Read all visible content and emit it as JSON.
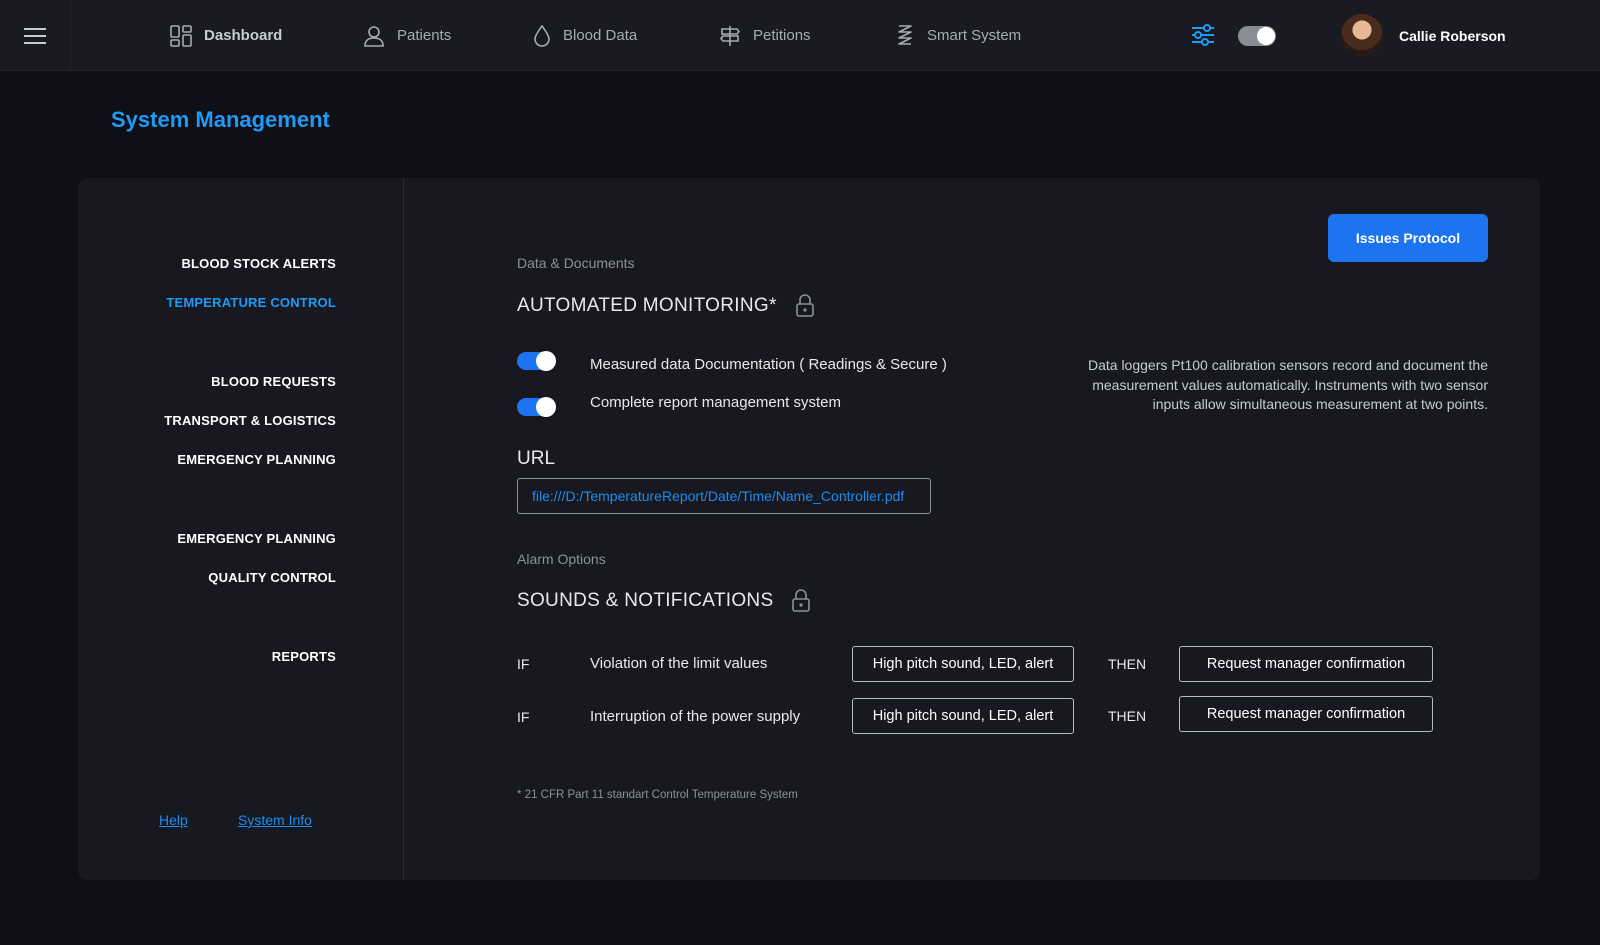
{
  "nav": {
    "items": [
      {
        "label": "Dashboard",
        "icon": "dashboard-icon"
      },
      {
        "label": "Patients",
        "icon": "user-icon"
      },
      {
        "label": "Blood Data",
        "icon": "drop-icon"
      },
      {
        "label": "Petitions",
        "icon": "signpost-icon"
      },
      {
        "label": "Smart System",
        "icon": "spring-icon"
      }
    ],
    "user_name": "Callie Roberson"
  },
  "page_title": "System Management",
  "sidebar": {
    "items": [
      "BLOOD STOCK ALERTS",
      "TEMPERATURE CONTROL",
      "BLOOD REQUESTS",
      "TRANSPORT & LOGISTICS",
      "EMERGENCY PLANNING",
      "EMERGENCY PLANNING",
      "QUALITY CONTROL",
      "REPORTS"
    ],
    "active": "TEMPERATURE CONTROL",
    "links": [
      "Help",
      "System Info"
    ]
  },
  "main": {
    "issues_button": "Issues  Protocol",
    "data_section": {
      "subtitle": "Data & Documents",
      "title": "AUTOMATED MONITORING*",
      "options": [
        {
          "label": "Measured data Documentation ( Readings & Secure )",
          "enabled": true
        },
        {
          "label": "Complete report management system",
          "enabled": true
        }
      ],
      "description": "Data loggers Pt100 calibration sensors record and document the measurement values automatically.  Instruments with two sensor inputs allow simultaneous measurement at two points."
    },
    "url": {
      "label": "URL",
      "value": "file:///D:/TemperatureReport/Date/Time/Name_Controller.pdf"
    },
    "alarm_section": {
      "subtitle": "Alarm Options",
      "title": "SOUNDS & NOTIFICATIONS",
      "rules": [
        {
          "if": "IF",
          "condition": "Violation of the limit values",
          "action": "High pitch sound, LED, alert",
          "then": "THEN",
          "result": "Request manager confirmation"
        },
        {
          "if": "IF",
          "condition": "Interruption of the power supply",
          "action": "High pitch sound, LED, alert",
          "then": "THEN",
          "result": "Request manager confirmation"
        }
      ]
    },
    "footnote": "* 21 CFR Part 11 standart Control Temperature System"
  },
  "colors": {
    "accent": "#1d9bf5",
    "toggle_on": "#1d74f0",
    "background": "#0f0f17",
    "card": "#181920"
  }
}
